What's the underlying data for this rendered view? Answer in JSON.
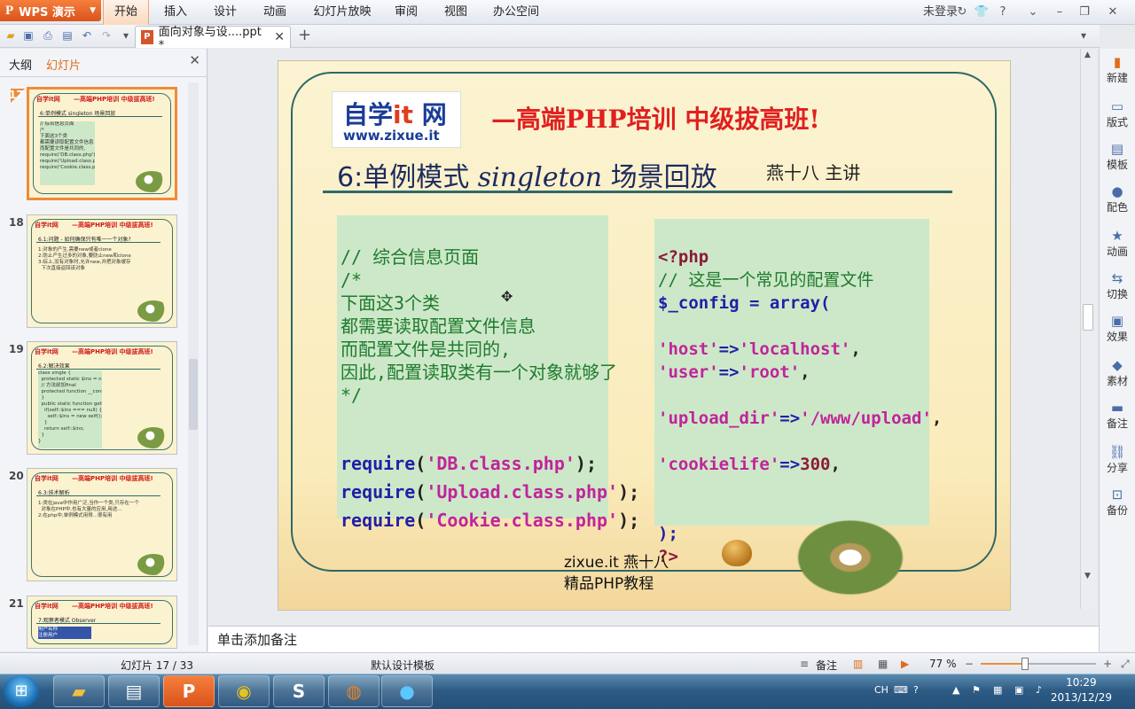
{
  "app": {
    "name": "WPS 演示"
  },
  "menu": [
    "开始",
    "插入",
    "设计",
    "动画",
    "幻灯片放映",
    "审阅",
    "视图",
    "办公空间"
  ],
  "menu_active": "开始",
  "login": "未登录",
  "tab": {
    "title": "面向对象与设....ppt *"
  },
  "leftpane": {
    "tab_outline": "大纲",
    "tab_slides": "幻灯片"
  },
  "thumbs": [
    {
      "no": "17",
      "title": "—高端PHP培训  中级拔高班!",
      "sub": "6:单例模式 singleton 场景回放",
      "text": "// 综合信息页面\n/*\n下面这3个类\n都需要读取配置文件信息\n而配置文件是共同的,\nrequire('DB.class.php');\nrequire('Upload.class.php');\nrequire('Cookie.class.php');"
    },
    {
      "no": "18",
      "title": "—高端PHP培训  中级拔高班!",
      "sub": "6.1:问题 - 如何确保只有唯一一个对象?",
      "text": "1:对象的产生,需要new或者clone\n2:防止产生过多的对象,要防止new和clone\n3:综上,没有对象时,允许new,并把对象缓存\n  下次直接返回该对象"
    },
    {
      "no": "19",
      "title": "—高端PHP培训  中级拔高班!",
      "sub": "6.2:解决效果",
      "text": "class single {\n  protected static $ins = null;\n  // 方法前加final\n  protected function __construct() {\n  }\n  public static function getIns() {\n    if(self::$ins === null) {\n      self::$ins = new self();\n    }\n    return self::$ins;\n  }\n}"
    },
    {
      "no": "20",
      "title": "—高端PHP培训  中级拔高班!",
      "sub": "6.3:技术解析",
      "text": "1:类在java中作用广泛,当作一个类,只存在一个\n  对象在PHP中,也有大量的应用,用途...\n2:在php中,单例模式用得...很有用"
    },
    {
      "no": "21",
      "title": "—高端PHP培训  中级拔高班!",
      "sub": "7:观察者模式 Observer",
      "text": "用户名称\n注册用户\n"
    }
  ],
  "slide": {
    "logo_text": "自学",
    "logo_it": "it",
    "logo_net": "网",
    "logo_url": "www.zixue.it",
    "title": "—高端PHP培训  中级拔高班!",
    "subtitle_prefix": "6:单例模式 ",
    "subtitle_italic": "singleton",
    "subtitle_suffix": " 场景回放",
    "author": "燕十八 主讲",
    "footer_line1": "zixue.it 燕十八",
    "footer_line2": "精品PHP教程"
  },
  "code_left": [
    {
      "t": "// 综合信息页面",
      "c": "cmt"
    },
    {
      "t": "/*",
      "c": "cmt"
    },
    {
      "t": "下面这3个类",
      "c": "cmt"
    },
    {
      "t": "都需要读取配置文件信息",
      "c": "cmt"
    },
    {
      "t": "而配置文件是共同的,",
      "c": "cmt"
    },
    {
      "t": "因此,配置读取类有一个对象就够了",
      "c": "cmt"
    },
    {
      "t": "*/",
      "c": "cmt"
    }
  ],
  "code_left_requires": [
    "'DB.class.php'",
    "'Upload.class.php'",
    "'Cookie.class.php'"
  ],
  "code_left_kw": "require",
  "code_right": {
    "open": "<?php",
    "comment": "// 这是一个常见的配置文件",
    "var": "$_config",
    "eq": " = ",
    "fn": "array(",
    "host_k": "'host'",
    "host_v": "'localhost'",
    "user_k": "'user'",
    "user_v": "'root'",
    "upload_k": "'upload_dir'",
    "upload_v": "'/www/upload'",
    "cookie_k": "'cookielife'",
    "cookie_v": "300",
    "arrow": "=>",
    "close": ");",
    "end": "?>"
  },
  "notes_placeholder": "单击添加备注",
  "rightpanel": [
    "新建",
    "版式",
    "模板",
    "配色",
    "动画",
    "切换",
    "效果",
    "素材",
    "备注",
    "分享",
    "备份"
  ],
  "status": {
    "slide": "幻灯片 17 / 33",
    "template": "默认设计模板",
    "notes": "备注",
    "zoom": "77 %"
  },
  "taskbar": {
    "time": "10:29",
    "date": "2013/12/29",
    "lang": "CH"
  }
}
